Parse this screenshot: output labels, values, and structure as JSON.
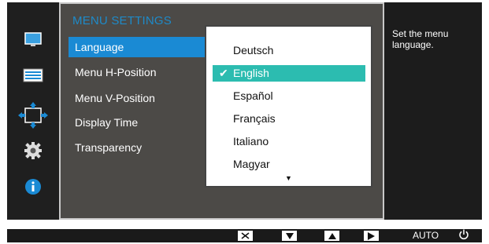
{
  "menu": {
    "title": "MENU SETTINGS",
    "items": [
      {
        "label": "Language"
      },
      {
        "label": "Menu H-Position"
      },
      {
        "label": "Menu V-Position"
      },
      {
        "label": "Display Time"
      },
      {
        "label": "Transparency"
      }
    ]
  },
  "dropdown": {
    "options": [
      {
        "label": "Deutsch"
      },
      {
        "label": "English"
      },
      {
        "label": "Español"
      },
      {
        "label": "Français"
      },
      {
        "label": "Italiano"
      },
      {
        "label": "Magyar"
      }
    ],
    "selected": "English"
  },
  "help": {
    "text": "Set the menu language."
  },
  "bottom_bar": {
    "auto_label": "AUTO"
  },
  "icons": [
    "picture-icon",
    "color-icon",
    "size-position-icon",
    "system-icon",
    "info-icon"
  ],
  "colors": {
    "highlight": "#1a8ad4",
    "selected_option": "#2cbcb0",
    "title": "#1e8ac8"
  }
}
